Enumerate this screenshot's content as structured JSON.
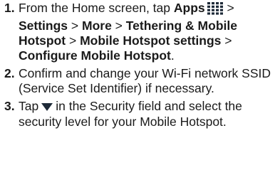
{
  "steps": [
    {
      "number": "1.",
      "parts": {
        "a": "From the Home screen, tap ",
        "apps": "Apps",
        "sep1": " > ",
        "settings": "Settings",
        "sep2": " > ",
        "more": "More",
        "sep3": " > ",
        "tethering": "Tethering & Mobile Hotspot",
        "sep4": " > ",
        "hotspot_settings": "Mobile Hotspot settings",
        "sep5": " > ",
        "configure": "Configure Mobile Hotspot",
        "end": "."
      },
      "icon": "apps-grid-icon"
    },
    {
      "number": "2.",
      "text": "Confirm and change your Wi-Fi network SSID (Service Set Identifier) if necessary."
    },
    {
      "number": "3.",
      "parts": {
        "a": "Tap",
        "b": "in the Security field and select the security level for your Mobile Hotspot."
      },
      "icon": "dropdown-arrow-icon"
    }
  ],
  "colors": {
    "text": "#1a1a1a",
    "icon": "#1e2a38"
  }
}
